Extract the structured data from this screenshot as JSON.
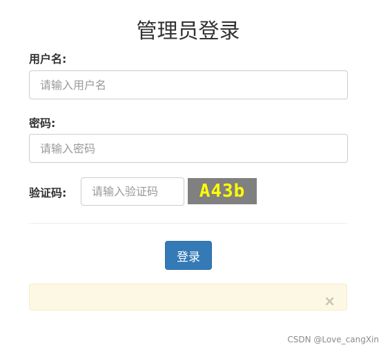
{
  "page": {
    "title": "管理员登录"
  },
  "form": {
    "username": {
      "label": "用户名:",
      "value": "",
      "placeholder": "请输入用户名"
    },
    "password": {
      "label": "密码:",
      "value": "",
      "placeholder": "请输入密码"
    },
    "captcha": {
      "label": "验证码:",
      "value": "",
      "placeholder": "请输入验证码",
      "image_text": "A43b",
      "image_text_color": "#ffff00",
      "image_bg_color": "#808080"
    },
    "submit_label": "登录"
  },
  "alert": {
    "message": "",
    "close_symbol": "×",
    "icon": "close-icon"
  },
  "watermark": "CSDN @Love_cangXin",
  "colors": {
    "primary": "#337ab7",
    "alert_bg": "#fcf8e3",
    "alert_border": "#faebcc"
  }
}
